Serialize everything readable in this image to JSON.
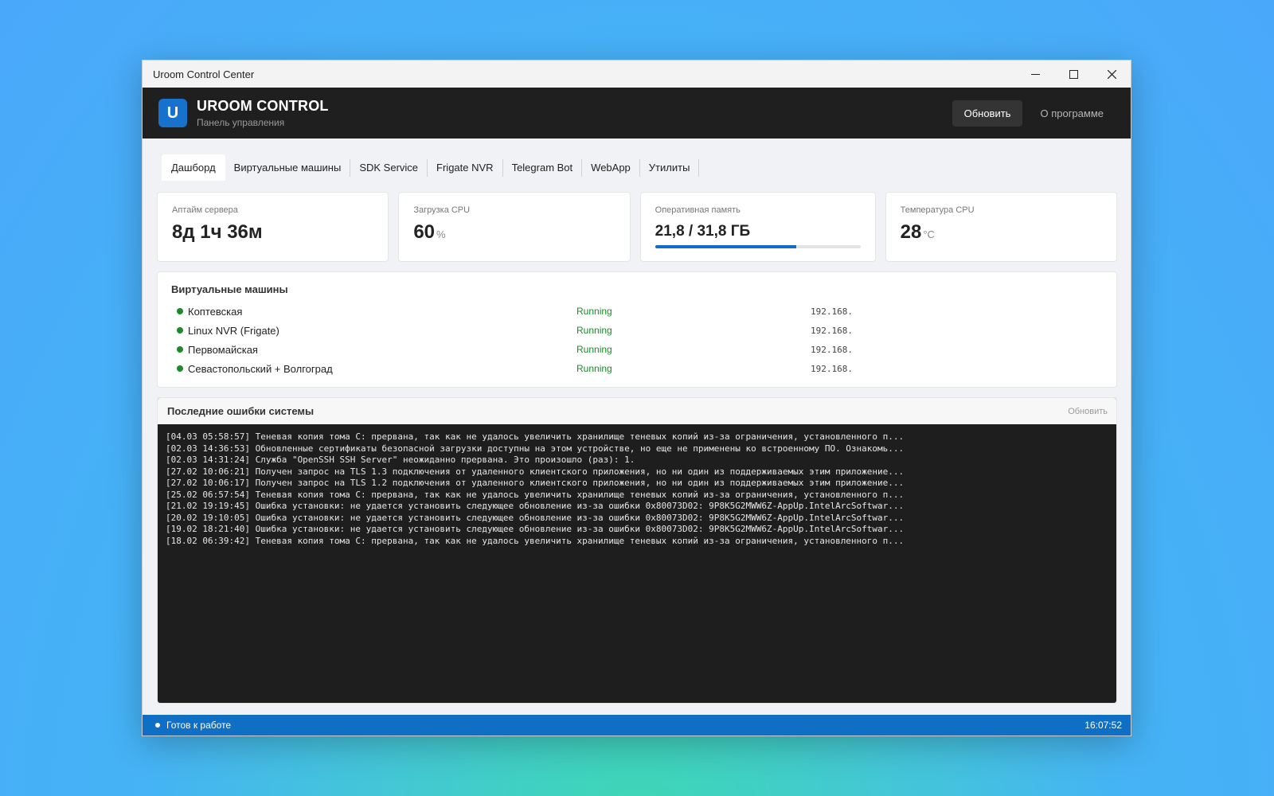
{
  "window": {
    "title": "Uroom Control Center"
  },
  "header": {
    "logo_letter": "U",
    "app_name": "UROOM CONTROL",
    "subtitle": "Панель управления",
    "refresh_label": "Обновить",
    "about_label": "О программе"
  },
  "tabs": [
    {
      "label": "Дашборд",
      "active": true
    },
    {
      "label": "Виртуальные машины"
    },
    {
      "label": "SDK Service"
    },
    {
      "label": "Frigate NVR"
    },
    {
      "label": "Telegram Bot"
    },
    {
      "label": "WebApp"
    },
    {
      "label": "Утилиты"
    }
  ],
  "stats": {
    "uptime": {
      "label": "Аптайм сервера",
      "value": "8д 1ч 36м"
    },
    "cpu": {
      "label": "Загрузка CPU",
      "value": "60",
      "unit": "%"
    },
    "memory": {
      "label": "Оперативная память",
      "value": "21,8 / 31,8 ГБ",
      "used_fraction": 0.686
    },
    "temp": {
      "label": "Температура CPU",
      "value": "28",
      "unit": "°C"
    }
  },
  "vms": {
    "title": "Виртуальные машины",
    "items": [
      {
        "name": "Коптевская",
        "status": "Running",
        "ip": "192.168."
      },
      {
        "name": "Linux NVR (Frigate)",
        "status": "Running",
        "ip": "192.168."
      },
      {
        "name": "Первомайская",
        "status": "Running",
        "ip": "192.168."
      },
      {
        "name": "Севастопольский + Волгоград",
        "status": "Running",
        "ip": "192.168."
      }
    ]
  },
  "errors": {
    "title": "Последние ошибки системы",
    "refresh_label": "Обновить",
    "lines": [
      "[04.03 05:58:57] Теневая копия тома C: прервана, так как не удалось увеличить хранилище теневых копий из-за ограничения, установленного п...",
      "[02.03 14:36:53] Обновленные сертификаты безопасной загрузки доступны на этом устройстве, но еще не применены ко встроенному ПО. Ознакомь...",
      "[02.03 14:31:24] Служба \"OpenSSH SSH Server\" неожиданно прервана. Это произошло (раз): 1.",
      "[27.02 10:06:21] Получен запрос на TLS 1.3 подключения от удаленного клиентского приложения, но ни один из поддерживаемых этим приложение...",
      "[27.02 10:06:17] Получен запрос на TLS 1.2 подключения от удаленного клиентского приложения, но ни один из поддерживаемых этим приложение...",
      "[25.02 06:57:54] Теневая копия тома C: прервана, так как не удалось увеличить хранилище теневых копий из-за ограничения, установленного п...",
      "[21.02 19:19:45] Ошибка установки: не удается установить следующее обновление из-за ошибки 0x80073D02: 9P8K5G2MWW6Z-AppUp.IntelArcSoftwar...",
      "[20.02 19:10:05] Ошибка установки: не удается установить следующее обновление из-за ошибки 0x80073D02: 9P8K5G2MWW6Z-AppUp.IntelArcSoftwar...",
      "[19.02 18:21:40] Ошибка установки: не удается установить следующее обновление из-за ошибки 0x80073D02: 9P8K5G2MWW6Z-AppUp.IntelArcSoftwar...",
      "[18.02 06:39:42] Теневая копия тома C: прервана, так как не удалось увеличить хранилище теневых копий из-за ограничения, установленного п..."
    ]
  },
  "statusbar": {
    "status": "Готов к работе",
    "time": "16:07:52"
  }
}
